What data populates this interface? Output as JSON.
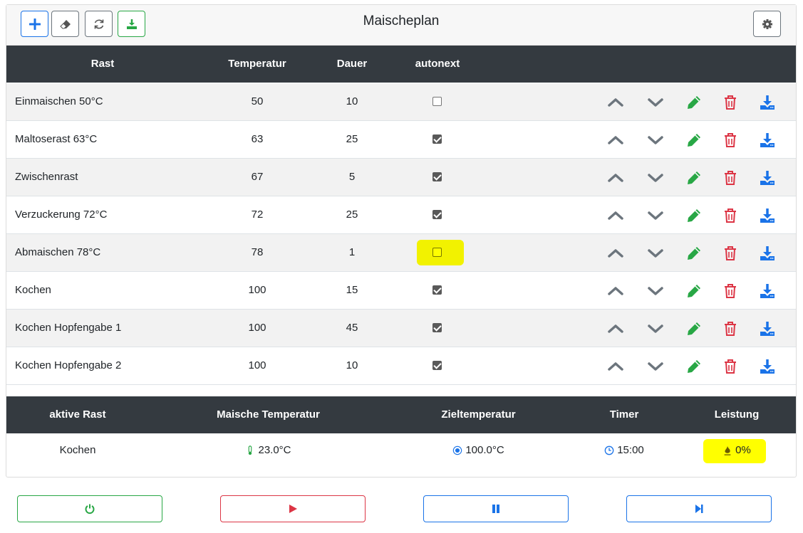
{
  "header": {
    "title": "Maischeplan",
    "buttons": [
      {
        "name": "add",
        "icon": "plus-icon"
      },
      {
        "name": "clear",
        "icon": "eraser-icon"
      },
      {
        "name": "refresh",
        "icon": "refresh-icon"
      },
      {
        "name": "download",
        "icon": "download-icon"
      },
      {
        "name": "settings",
        "icon": "gear-icon"
      }
    ]
  },
  "table": {
    "columns": [
      "Rast",
      "Temperatur",
      "Dauer",
      "autonext"
    ],
    "rows": [
      {
        "name": "Einmaischen 50°C",
        "temp": "50",
        "duration": "10",
        "autonext": false
      },
      {
        "name": "Maltoserast 63°C",
        "temp": "63",
        "duration": "25",
        "autonext": true
      },
      {
        "name": "Zwischenrast",
        "temp": "67",
        "duration": "5",
        "autonext": true
      },
      {
        "name": "Verzuckerung 72°C",
        "temp": "72",
        "duration": "25",
        "autonext": true
      },
      {
        "name": "Abmaischen 78°C",
        "temp": "78",
        "duration": "1",
        "autonext": false
      },
      {
        "name": "Kochen",
        "temp": "100",
        "duration": "15",
        "autonext": true
      },
      {
        "name": "Kochen Hopfengabe 1",
        "temp": "100",
        "duration": "45",
        "autonext": true
      },
      {
        "name": "Kochen Hopfengabe 2",
        "temp": "100",
        "duration": "10",
        "autonext": true
      }
    ],
    "row_actions": [
      "chevron-up-icon",
      "chevron-down-icon",
      "pencil-icon",
      "trash-icon",
      "download-icon"
    ]
  },
  "status": {
    "columns": [
      "aktive Rast",
      "Maische Temperatur",
      "Zieltemperatur",
      "Timer",
      "Leistung"
    ],
    "active_rast": "Kochen",
    "mash_temp": "23.0°C",
    "target_temp": "100.0°C",
    "timer": "15:00",
    "power": "0%"
  },
  "controls": [
    {
      "name": "power",
      "icon": "power-icon",
      "color": "#28a745"
    },
    {
      "name": "play",
      "icon": "play-icon",
      "color": "#dc3545"
    },
    {
      "name": "pause",
      "icon": "pause-icon",
      "color": "#1a73e8"
    },
    {
      "name": "skip",
      "icon": "skip-next-icon",
      "color": "#1a73e8"
    }
  ],
  "colors": {
    "header_dark": "#343a40",
    "blue": "#1a73e8",
    "green": "#28a745",
    "red": "#dc3545",
    "gray": "#6c757d",
    "highlight": "#ffff00"
  }
}
